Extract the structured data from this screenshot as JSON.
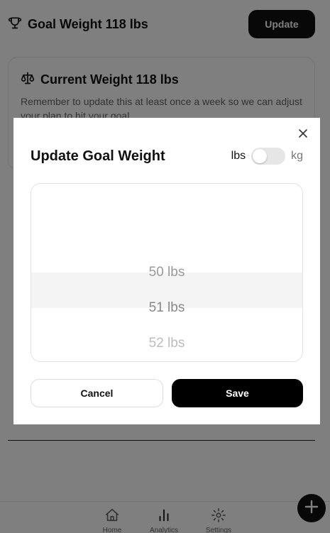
{
  "background": {
    "goal_title": "Goal Weight 118 lbs",
    "update_button": "Update",
    "current_weight_title": "Current Weight 118 lbs",
    "current_weight_text": "Remember to update this at least once a week so we can adjust your plan to hit your goal",
    "nav": [
      {
        "label": "Home",
        "icon": "home-icon"
      },
      {
        "label": "Analytics",
        "icon": "bar-chart-icon"
      },
      {
        "label": "Settings",
        "icon": "gear-icon"
      }
    ],
    "fab_icon": "plus-icon"
  },
  "modal": {
    "title": "Update Goal Weight",
    "unit_left": "lbs",
    "unit_right": "kg",
    "unit_toggle_on": false,
    "picker_items": [
      "50 lbs",
      "51 lbs",
      "52 lbs"
    ],
    "selected_index": 1,
    "cancel_label": "Cancel",
    "save_label": "Save",
    "close_icon": "close-icon"
  },
  "colors": {
    "primary": "#000000",
    "overlay": "rgba(0,0,0,0.5)"
  }
}
